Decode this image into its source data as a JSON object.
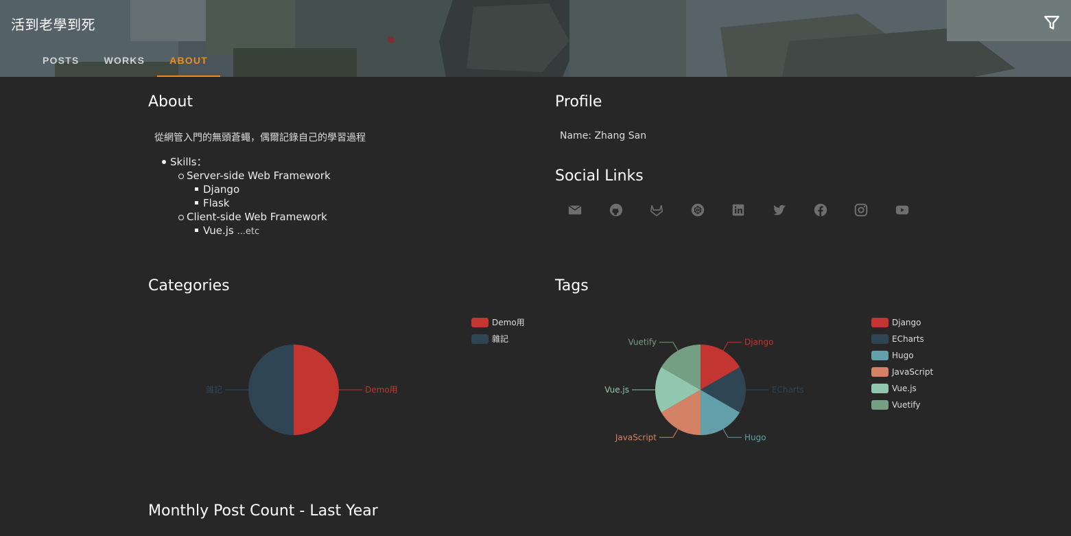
{
  "header": {
    "site_title": "活到老學到死",
    "tabs": [
      {
        "label": "POSTS",
        "active": false
      },
      {
        "label": "WORKS",
        "active": false
      },
      {
        "label": "ABOUT",
        "active": true
      }
    ],
    "filter_icon": "filter-icon",
    "accent_color": "#f08c1e"
  },
  "about": {
    "title": "About",
    "description": "從網管入門的無頭蒼蠅，偶爾記錄自己的學習過程",
    "skills": {
      "label": "Skills：",
      "groups": [
        {
          "label": "Server-side Web Framework",
          "items": [
            "Django",
            "Flask"
          ]
        },
        {
          "label": "Client-side Web Framework",
          "items": [
            "Vue.js"
          ],
          "suffix": "...etc"
        }
      ]
    }
  },
  "profile": {
    "title": "Profile",
    "name_line": "Name: Zhang San"
  },
  "social_links": {
    "title": "Social Links",
    "icons": [
      "email-icon",
      "github-icon",
      "gitlab-icon",
      "codepen-icon",
      "linkedin-icon",
      "twitter-icon",
      "facebook-icon",
      "instagram-icon",
      "youtube-icon"
    ],
    "icon_color": "#6e6e6e"
  },
  "categories": {
    "title": "Categories"
  },
  "tags": {
    "title": "Tags"
  },
  "monthly": {
    "title": "Monthly Post Count - Last Year"
  },
  "chart_data": [
    {
      "type": "pie",
      "title": "Categories",
      "categories": [
        "Demo用",
        "雜記"
      ],
      "values": [
        1,
        1
      ],
      "colors": [
        "#c23531",
        "#2f4554"
      ],
      "legend": "top-right"
    },
    {
      "type": "pie",
      "title": "Tags",
      "categories": [
        "Django",
        "ECharts",
        "Hugo",
        "JavaScript",
        "Vue.js",
        "Vuetify"
      ],
      "values": [
        1,
        1,
        1,
        1,
        1,
        1
      ],
      "colors": [
        "#c23531",
        "#2f4554",
        "#61a0a8",
        "#d48265",
        "#91c7ae",
        "#749f83"
      ],
      "legend": "top-right"
    }
  ]
}
